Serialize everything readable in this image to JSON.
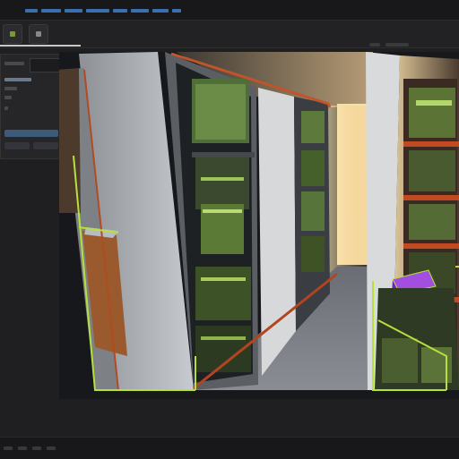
{
  "app": {
    "accent_color": "#4a8fd8",
    "highlight_color": "#b6e13a"
  },
  "viewport": {
    "corner_label": "",
    "sub_label": "",
    "scene": {
      "description_icon": "server-room-3d-scene",
      "crate_color": "#7a2ad0"
    }
  },
  "icons": {
    "menu": "menu-icon",
    "move": "move-tool-icon",
    "crate": "crate-icon"
  }
}
